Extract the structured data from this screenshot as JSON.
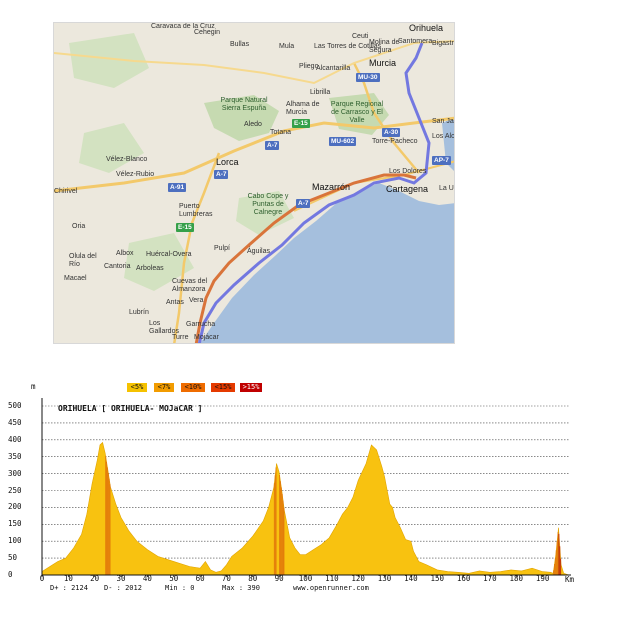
{
  "map": {
    "colors": {
      "land": "#ece8dd",
      "sea": "#a5bfdd",
      "green": "#c6dab1",
      "route_blue": "#7378e0",
      "route_orange": "#d9743a",
      "road": "#f3c96a"
    },
    "places": {
      "caravaca": "Caravaca de la Cruz",
      "cehegin": "Cehegin",
      "bullas": "Bullas",
      "mula": "Mula",
      "torres": "Las Torres de Cotillas",
      "orihuela": "Orihuela",
      "molina": "Molina de Segura",
      "santomera": "Santomera",
      "bigastro": "Bigastro",
      "ceuti": "Ceuti",
      "alcantarilla": "Alcantarilla",
      "murcia": "Murcia",
      "pliego": "Pliego",
      "librilla": "Librilla",
      "parque_sierra": "Parque Natural Sierra Espuña",
      "alhama": "Alhama de Murcia",
      "parque_carrasco": "Parque Regional de Carrasco y El Valle",
      "aledo": "Aledo",
      "totana": "Totana",
      "torre_pacheco": "Torre-Pacheco",
      "san_jav": "San Ja",
      "los_alcaz": "Los Alcaz",
      "velez_blanco": "Vélez-Blanco",
      "velez_rubio": "Vélez-Rubio",
      "lorca": "Lorca",
      "chirivel": "Chirivel",
      "mazarron": "Mazarrón",
      "cartagena": "Cartagena",
      "la_union": "La Uni",
      "cabo_cope": "Cabo Cope y Puntas de Calnegre",
      "puerto": "Puerto Lumbreras",
      "oria": "Oria",
      "pulpi": "Pulpí",
      "aguilas": "Águilas",
      "olula": "Olula del Río",
      "albox": "Albox",
      "huercal": "Huércal-Overa",
      "cantoria": "Cantoria",
      "macael": "Macael",
      "arboleas": "Arboleas",
      "cuevas": "Cuevas del Almanzora",
      "antas": "Antas",
      "vera": "Vera",
      "lubrin": "Lubrín",
      "los_gallardos": "Los Gallardos",
      "garrucha": "Garrucha",
      "turre": "Turre",
      "mojacar": "Mojácar",
      "los_dolores": "Los Dolores"
    },
    "shields": {
      "mu30": "MU-30",
      "a7a": "A-7",
      "a7b": "A-7",
      "a7c": "A-7",
      "a7d": "A-7",
      "a30": "A-30",
      "mu602": "MU-602",
      "ap7": "AP-7",
      "e15a": "E-15",
      "e15b": "E-15",
      "a91": "A-91"
    }
  },
  "profile": {
    "title": "ORIHUELA [ ORIHUELA- MOJaCAR ]",
    "y_unit": "m",
    "x_unit": "Km",
    "legend": [
      "<5%",
      "<7%",
      "<10%",
      "<15%",
      ">15%"
    ],
    "legend_colors": [
      "#f5c200",
      "#f29c00",
      "#ef6c00",
      "#e53a00",
      "#c00000"
    ],
    "stats": {
      "dplus": "D+ : 2124",
      "dminus": "D- : 2012",
      "min": "Min : 0",
      "max": "Max : 390"
    },
    "site": "www.openrunner.com",
    "colors": {
      "fill": "#f8c210",
      "steep": "#e0700a",
      "steepest": "#b81a08"
    }
  },
  "chart_data": {
    "type": "area",
    "title": "ORIHUELA [ ORIHUELA- MOJaCAR ]",
    "xlabel": "Km",
    "ylabel": "m",
    "ylim": [
      0,
      500
    ],
    "xlim": [
      0,
      200
    ],
    "yticks": [
      "0",
      "50",
      "100",
      "150",
      "200",
      "250",
      "300",
      "350",
      "400",
      "450",
      "500"
    ],
    "xticks": [
      "0",
      "10",
      "20",
      "30",
      "40",
      "50",
      "60",
      "70",
      "80",
      "90",
      "100",
      "110",
      "120",
      "130",
      "140",
      "150",
      "160",
      "170",
      "180",
      "190"
    ],
    "x": [
      0,
      3,
      6,
      9,
      12,
      15,
      17,
      19,
      21,
      22,
      23,
      24,
      25,
      26,
      28,
      30,
      33,
      36,
      40,
      44,
      48,
      52,
      56,
      60,
      62,
      64,
      66,
      68,
      70,
      72,
      76,
      80,
      84,
      86,
      88,
      89,
      90,
      91,
      92,
      93,
      94,
      96,
      98,
      100,
      103,
      106,
      109,
      112,
      114,
      116,
      118,
      120,
      123,
      125,
      127,
      129,
      130,
      131,
      132,
      133,
      134,
      136,
      138,
      140,
      141,
      143,
      146,
      150,
      154,
      158,
      162,
      166,
      170,
      174,
      178,
      182,
      186,
      190,
      193,
      194,
      195,
      196,
      197,
      198,
      200
    ],
    "y": [
      10,
      25,
      40,
      50,
      80,
      120,
      180,
      270,
      340,
      385,
      392,
      360,
      310,
      260,
      210,
      170,
      130,
      100,
      75,
      55,
      45,
      35,
      25,
      20,
      40,
      15,
      8,
      12,
      30,
      55,
      80,
      115,
      160,
      200,
      260,
      330,
      305,
      250,
      190,
      150,
      110,
      80,
      60,
      60,
      75,
      90,
      110,
      150,
      180,
      200,
      230,
      280,
      330,
      385,
      370,
      320,
      290,
      250,
      210,
      200,
      170,
      140,
      105,
      100,
      70,
      40,
      30,
      15,
      10,
      8,
      5,
      12,
      8,
      10,
      15,
      12,
      20,
      10,
      8,
      5,
      60,
      140,
      30,
      5,
      0
    ],
    "legend": [
      "<5%",
      "<7%",
      "<10%",
      "<15%",
      ">15%"
    ],
    "grid": true
  }
}
